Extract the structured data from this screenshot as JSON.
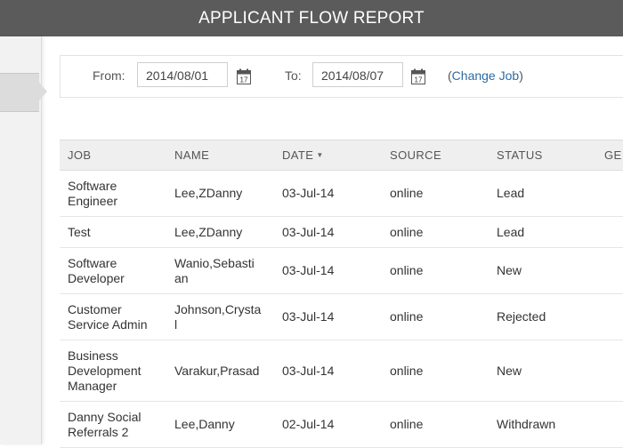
{
  "title": "APPLICANT FLOW REPORT",
  "filters": {
    "from_label": "From:",
    "from_value": "2014/08/01",
    "to_label": "To:",
    "to_value": "2014/08/07",
    "change_job_open": "(",
    "change_job_link": "Change Job",
    "change_job_close": ")"
  },
  "icons": {
    "calendar": "calendar-icon",
    "calendar_day": "17",
    "sort": "caret-down-icon"
  },
  "table": {
    "headers": [
      "JOB",
      "NAME",
      "DATE",
      "SOURCE",
      "STATUS",
      "GE"
    ],
    "rows": [
      {
        "job": "Software\nEngineer",
        "name": "Lee,ZDanny",
        "date": "03-Jul-14",
        "source": "online",
        "status": "Lead",
        "gender": ""
      },
      {
        "job": "Test",
        "name": "Lee,ZDanny",
        "date": "03-Jul-14",
        "source": "online",
        "status": "Lead",
        "gender": ""
      },
      {
        "job": "Software\nDeveloper",
        "name": "Wanio,Sebasti\nan",
        "date": "03-Jul-14",
        "source": "online",
        "status": "New",
        "gender": ""
      },
      {
        "job": "Customer\nService Admin",
        "name": "Johnson,Crysta\nl",
        "date": "03-Jul-14",
        "source": "online",
        "status": "Rejected",
        "gender": ""
      },
      {
        "job": "Business\nDevelopment\nManager",
        "name": "Varakur,Prasad",
        "date": "03-Jul-14",
        "source": "online",
        "status": "New",
        "gender": ""
      },
      {
        "job": "Danny Social\nReferrals 2",
        "name": "Lee,Danny",
        "date": "02-Jul-14",
        "source": "online",
        "status": "Withdrawn",
        "gender": ""
      }
    ]
  },
  "colors": {
    "title_bar": "#5b5b5b",
    "link": "#2d6aa6",
    "header_bg": "#efefef"
  }
}
